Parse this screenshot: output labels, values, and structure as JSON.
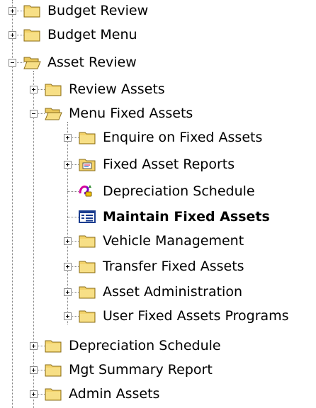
{
  "tree": {
    "items": [
      {
        "label": "Budget Review",
        "icon": "folder-closed-icon",
        "level": 0,
        "toggle": "plus"
      },
      {
        "label": "Budget Menu",
        "icon": "folder-closed-icon",
        "level": 0,
        "toggle": "plus"
      },
      {
        "label": "Asset Review",
        "icon": "folder-open-icon",
        "level": 0,
        "toggle": "minus"
      },
      {
        "label": "Review Assets",
        "icon": "folder-closed-icon",
        "level": 1,
        "toggle": "plus"
      },
      {
        "label": "Menu Fixed Assets",
        "icon": "folder-open-icon",
        "level": 1,
        "toggle": "minus"
      },
      {
        "label": "Enquire on Fixed Assets",
        "icon": "folder-closed-icon",
        "level": 2,
        "toggle": "plus"
      },
      {
        "label": "Fixed Asset Reports",
        "icon": "report-folder-icon",
        "level": 2,
        "toggle": "plus"
      },
      {
        "label": "Depreciation Schedule",
        "icon": "report-program-icon",
        "level": 2,
        "toggle": "none"
      },
      {
        "label": "Maintain Fixed Assets",
        "icon": "form-program-icon",
        "level": 2,
        "toggle": "none",
        "bold": true
      },
      {
        "label": "Vehicle Management",
        "icon": "folder-closed-icon",
        "level": 2,
        "toggle": "plus"
      },
      {
        "label": "Transfer Fixed Assets",
        "icon": "folder-closed-icon",
        "level": 2,
        "toggle": "plus"
      },
      {
        "label": "Asset Administration",
        "icon": "folder-closed-icon",
        "level": 2,
        "toggle": "plus"
      },
      {
        "label": "User Fixed Assets Programs",
        "icon": "folder-closed-icon",
        "level": 2,
        "toggle": "plus"
      },
      {
        "label": "Depreciation Schedule",
        "icon": "folder-closed-icon",
        "level": 1,
        "toggle": "plus"
      },
      {
        "label": "Mgt Summary Report",
        "icon": "folder-closed-icon",
        "level": 1,
        "toggle": "plus"
      },
      {
        "label": "Admin Assets",
        "icon": "folder-closed-icon",
        "level": 1,
        "toggle": "plus"
      }
    ]
  }
}
